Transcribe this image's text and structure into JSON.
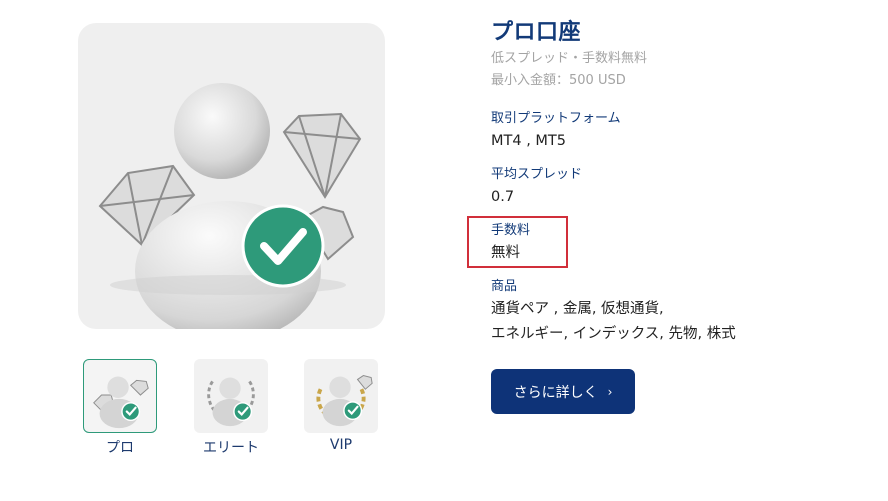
{
  "product": {
    "title": "プロ口座",
    "subtitle": "低スプレッド・手数料無料",
    "min_deposit": "最小入金額：500 USD",
    "hero_icon": "user-with-diamonds-check-icon"
  },
  "specs": [
    {
      "label": "取引プラットフォーム",
      "value": "MT4 , MT5"
    },
    {
      "label": "平均スプレッド",
      "value": "0.7"
    },
    {
      "label": "手数料",
      "value": "無料"
    },
    {
      "label": "商品",
      "value_lines": [
        "通貨ペア , 金属, 仮想通貨,",
        "エネルギー, インデックス, 先物, 株式"
      ]
    }
  ],
  "accounts": [
    {
      "label": "プロ",
      "icon": "user-diamonds-icon",
      "active": true
    },
    {
      "label": "エリート",
      "icon": "user-silver-laurel-icon",
      "active": false
    },
    {
      "label": "VIP",
      "icon": "user-gold-laurel-icon",
      "active": false
    }
  ],
  "cta": {
    "label": "さらに詳しく",
    "chevron": "›"
  },
  "colors": {
    "brand": "#123a78",
    "button": "#0e3378",
    "check": "#2e9a7a",
    "highlight": "#d12f3a"
  }
}
